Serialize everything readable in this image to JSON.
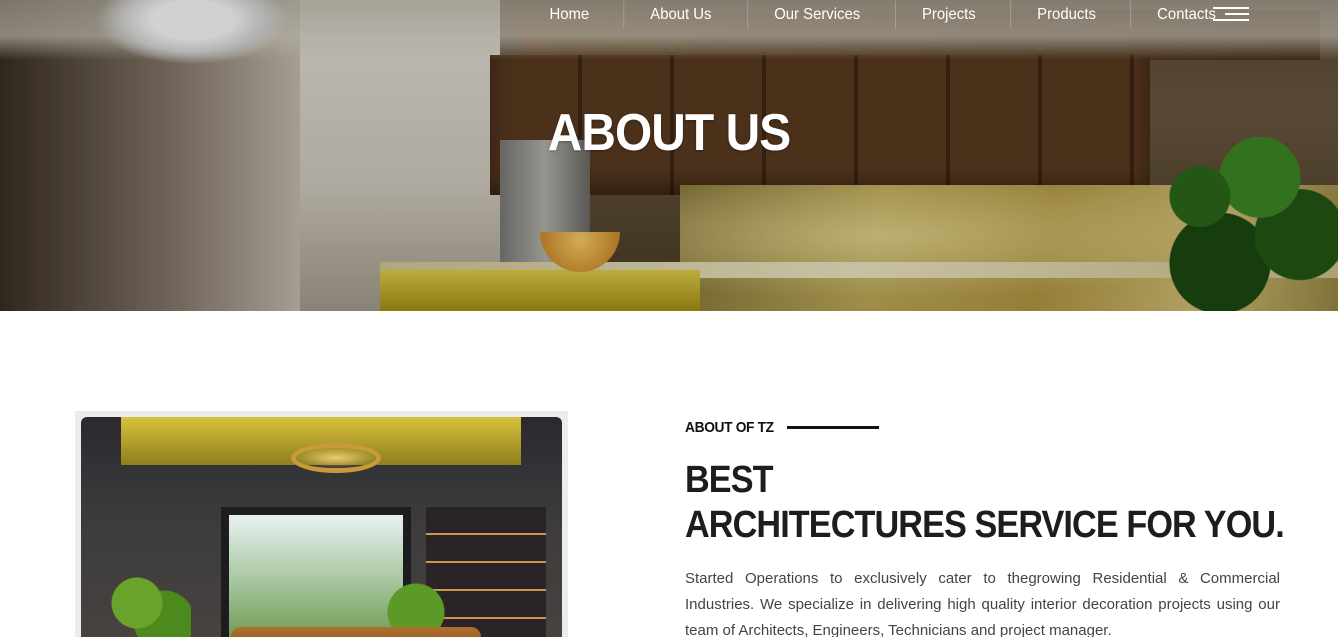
{
  "nav": {
    "items": [
      {
        "label": "Home"
      },
      {
        "label": "About Us"
      },
      {
        "label": "Our Services"
      },
      {
        "label": "Projects"
      },
      {
        "label": "Products"
      },
      {
        "label": "Contacts"
      }
    ],
    "menu_icon": "hamburger-icon"
  },
  "hero": {
    "title": "ABOUT US"
  },
  "about": {
    "kicker": "ABOUT OF TZ",
    "heading_line1": "BEST",
    "heading_line2": "ARCHITECTURES SERVICE FOR YOU.",
    "paragraph": "Started Operations to exclusively cater to thegrowing Residential & Commercial Industries. We specialize in delivering high quality interior decoration projects using our team of Architects, Engineers, Technicians and project manager."
  },
  "colors": {
    "text_dark": "#1d1d1d",
    "text_body": "#444444",
    "nav_text": "#ffffff"
  }
}
